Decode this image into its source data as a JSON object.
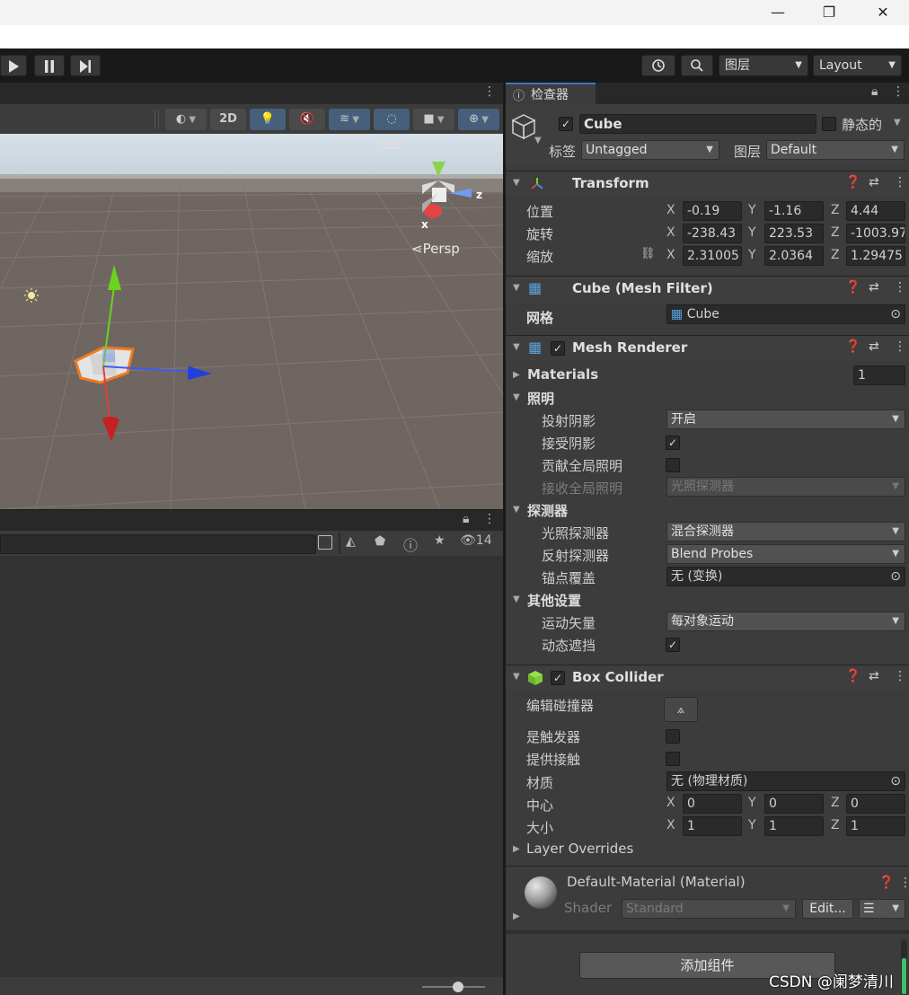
{
  "window": {
    "minimize": "—",
    "restore": "❐",
    "close": "✕"
  },
  "toolbar": {
    "play_icon": "play-icon",
    "pause_icon": "pause-icon",
    "step_icon": "step-icon",
    "layers_label": "图层",
    "layout_label": "Layout"
  },
  "scene": {
    "btn_2d": "2D",
    "persp_label": "Persp",
    "gizmo_z": "z",
    "gizmo_x": "x"
  },
  "project": {
    "count": "14"
  },
  "inspector": {
    "tab_label": "检查器",
    "object_name": "Cube",
    "static_label": "静态的",
    "tag_label": "标签",
    "tag_value": "Untagged",
    "layer_label": "图层",
    "layer_value": "Default",
    "transform": {
      "title": "Transform",
      "rows": [
        {
          "label": "位置",
          "x": "-0.19",
          "y": "-1.16",
          "z": "4.44"
        },
        {
          "label": "旋转",
          "x": "-238.43",
          "y": "223.53",
          "z": "-1003.97"
        },
        {
          "label": "缩放",
          "x": "2.31005",
          "y": "2.0364",
          "z": "1.29475"
        }
      ],
      "axis_x": "X",
      "axis_y": "Y",
      "axis_z": "Z"
    },
    "mesh_filter": {
      "title": "Cube (Mesh Filter)",
      "mesh_label": "网格",
      "mesh_value": "Cube"
    },
    "mesh_renderer": {
      "title": "Mesh Renderer",
      "materials_label": "Materials",
      "materials_count": "1",
      "lighting_label": "照明",
      "cast_shadows_label": "投射阴影",
      "cast_shadows_value": "开启",
      "receive_shadows_label": "接受阴影",
      "contribute_gi_label": "贡献全局照明",
      "receive_gi_label": "接收全局照明",
      "receive_gi_value": "光照探测器",
      "probes_label": "探测器",
      "light_probes_label": "光照探测器",
      "light_probes_value": "混合探测器",
      "reflection_probes_label": "反射探测器",
      "reflection_probes_value": "Blend Probes",
      "anchor_label": "锚点覆盖",
      "anchor_value": "无 (变换)",
      "other_label": "其他设置",
      "motion_label": "运动矢量",
      "motion_value": "每对象运动",
      "occlusion_label": "动态遮挡"
    },
    "box_collider": {
      "title": "Box Collider",
      "edit_label": "编辑碰撞器",
      "trigger_label": "是触发器",
      "contacts_label": "提供接触",
      "material_label": "材质",
      "material_value": "无 (物理材质)",
      "center_label": "中心",
      "center": {
        "x": "0",
        "y": "0",
        "z": "0"
      },
      "size_label": "大小",
      "size": {
        "x": "1",
        "y": "1",
        "z": "1"
      },
      "layer_overrides_label": "Layer Overrides"
    },
    "material": {
      "title": "Default-Material (Material)",
      "shader_label": "Shader",
      "shader_value": "Standard",
      "edit_label": "Edit..."
    },
    "add_component": "添加组件"
  },
  "watermark": "CSDN @阑梦清川",
  "colors": {
    "selection_blue": "#46607c",
    "axis_x": "#e23d3d",
    "axis_y": "#6cd31c",
    "axis_z": "#3d5cf2",
    "outline_orange": "#f07a1c"
  }
}
